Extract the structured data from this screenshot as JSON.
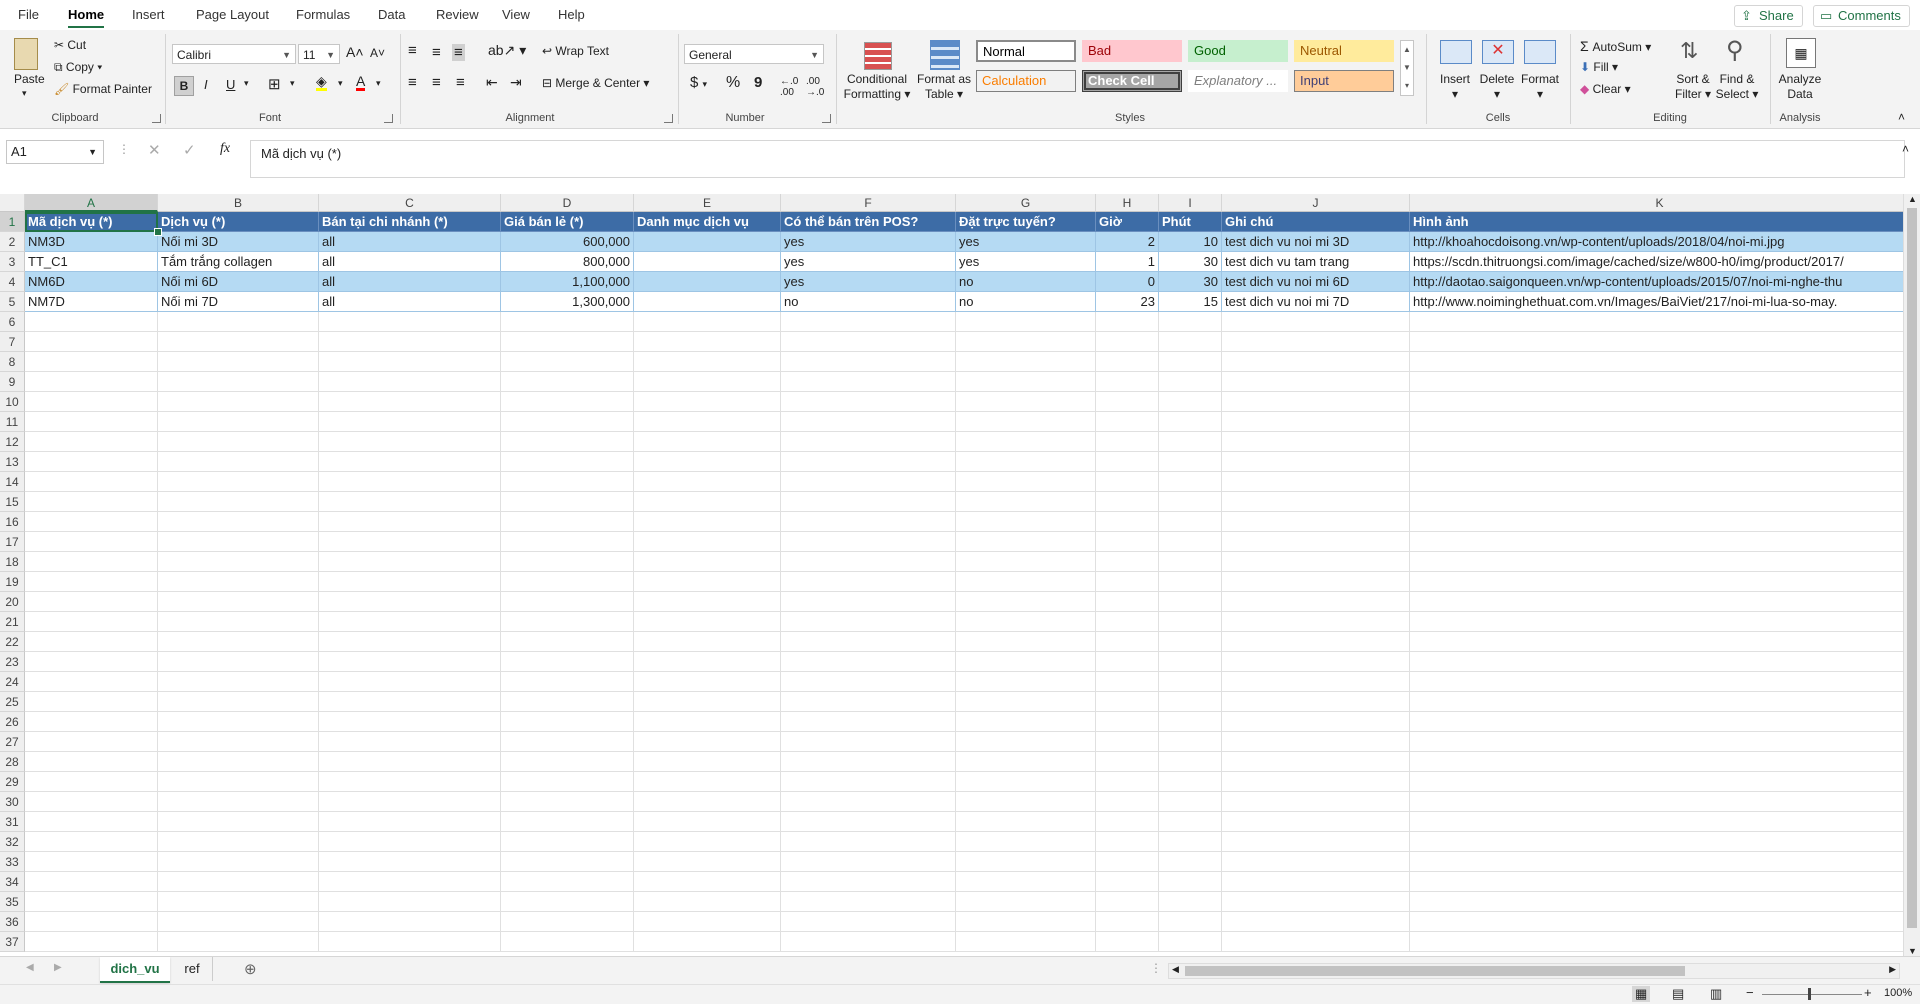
{
  "menu": {
    "tabs": [
      "File",
      "Home",
      "Insert",
      "Page Layout",
      "Formulas",
      "Data",
      "Review",
      "View",
      "Help"
    ],
    "active": "Home",
    "share": "Share",
    "comments": "Comments"
  },
  "ribbon": {
    "clipboard": {
      "paste": "Paste",
      "cut": "Cut",
      "copy": "Copy",
      "format_painter": "Format Painter",
      "label": "Clipboard"
    },
    "font": {
      "name": "Calibri",
      "size": "11",
      "label": "Font",
      "bold": "B",
      "italic": "I",
      "underline": "U"
    },
    "alignment": {
      "wrap_text": "Wrap Text",
      "merge_center": "Merge & Center",
      "label": "Alignment"
    },
    "number": {
      "format": "General",
      "currency": "$",
      "percent": "%",
      "comma": "9",
      "label": "Number"
    },
    "styles": {
      "conditional": "Conditional",
      "conditional2": "Formatting",
      "format_as": "Format as",
      "table": "Table",
      "cells": [
        {
          "label": "Normal",
          "bg": "#ffffff",
          "fg": "#000000",
          "border": "#8a8a8a"
        },
        {
          "label": "Bad",
          "bg": "#ffc7ce",
          "fg": "#9c0006",
          "border": "#ffc7ce"
        },
        {
          "label": "Good",
          "bg": "#c6efce",
          "fg": "#006100",
          "border": "#c6efce"
        },
        {
          "label": "Neutral",
          "bg": "#ffeb9c",
          "fg": "#9c5700",
          "border": "#ffeb9c"
        },
        {
          "label": "Calculation",
          "bg": "#f2f2f2",
          "fg": "#fa7d00",
          "border": "#7f7f7f"
        },
        {
          "label": "Check Cell",
          "bg": "#a5a5a5",
          "fg": "#ffffff",
          "border": "#3f3f3f"
        },
        {
          "label": "Explanatory ...",
          "bg": "#ffffff",
          "fg": "#7f7f7f",
          "border": "#ffffff"
        },
        {
          "label": "Input",
          "bg": "#ffcc99",
          "fg": "#3f3f76",
          "border": "#7f7f7f"
        }
      ],
      "label": "Styles"
    },
    "cells": {
      "insert": "Insert",
      "delete": "Delete",
      "format": "Format",
      "label": "Cells"
    },
    "editing": {
      "autosum": "AutoSum",
      "fill": "Fill",
      "clear": "Clear",
      "sort": "Sort &",
      "sort2": "Filter",
      "find": "Find &",
      "find2": "Select",
      "label": "Editing"
    },
    "analysis": {
      "analyze": "Analyze",
      "analyze2": "Data",
      "label": "Analysis"
    }
  },
  "formula_bar": {
    "name_box": "A1",
    "formula": "Mã dịch vụ (*)",
    "fx": "fx"
  },
  "columns": [
    {
      "letter": "A"
    },
    {
      "letter": "B"
    },
    {
      "letter": "C"
    },
    {
      "letter": "D"
    },
    {
      "letter": "E"
    },
    {
      "letter": "F"
    },
    {
      "letter": "G"
    },
    {
      "letter": "H"
    },
    {
      "letter": "I"
    },
    {
      "letter": "J"
    },
    {
      "letter": "K"
    }
  ],
  "header_row": [
    "Mã dịch vụ (*)",
    "Dịch vụ (*)",
    "Bán tại chi nhánh (*)",
    "Giá bán lẻ (*)",
    "Danh mục dịch vụ",
    "Có thể bán trên POS?",
    "Đặt trực tuyến?",
    "Giờ",
    "Phút",
    "Ghi chú",
    "Hình ảnh"
  ],
  "rows": [
    [
      "NM3D",
      "Nối mi 3D",
      "all",
      "600,000",
      "",
      "yes",
      "yes",
      "2",
      "10",
      "test dich vu noi mi 3D",
      "http://khoahocdoisong.vn/wp-content/uploads/2018/04/noi-mi.jpg"
    ],
    [
      "TT_C1",
      "Tắm trắng collagen",
      "all",
      "800,000",
      "",
      "yes",
      "yes",
      "1",
      "30",
      "test dich vu tam trang",
      "https://scdn.thitruongsi.com/image/cached/size/w800-h0/img/product/2017/"
    ],
    [
      "NM6D",
      "Nối mi 6D",
      "all",
      "1,100,000",
      "",
      "yes",
      "no",
      "0",
      "30",
      "test dich vu noi mi 6D",
      "http://daotao.saigonqueen.vn/wp-content/uploads/2015/07/noi-mi-nghe-thu"
    ],
    [
      "NM7D",
      "Nối mi 7D",
      "all",
      "1,300,000",
      "",
      "no",
      "no",
      "23",
      "15",
      "test dich vu noi mi 7D",
      "http://www.noiminghethuat.com.vn/Images/BaiViet/217/noi-mi-lua-so-may."
    ]
  ],
  "row_numbers": [
    "1",
    "2",
    "3",
    "4",
    "5",
    "6",
    "7",
    "8",
    "9",
    "10",
    "11",
    "12",
    "13",
    "14",
    "15",
    "16",
    "17",
    "18",
    "19",
    "20",
    "21",
    "22",
    "23",
    "24",
    "25",
    "26",
    "27",
    "28",
    "29",
    "30",
    "31",
    "32",
    "33",
    "34",
    "35",
    "36",
    "37"
  ],
  "sheets": {
    "tabs": [
      "dich_vu",
      "ref"
    ],
    "active": "dich_vu"
  },
  "status": {
    "zoom": "100%"
  }
}
